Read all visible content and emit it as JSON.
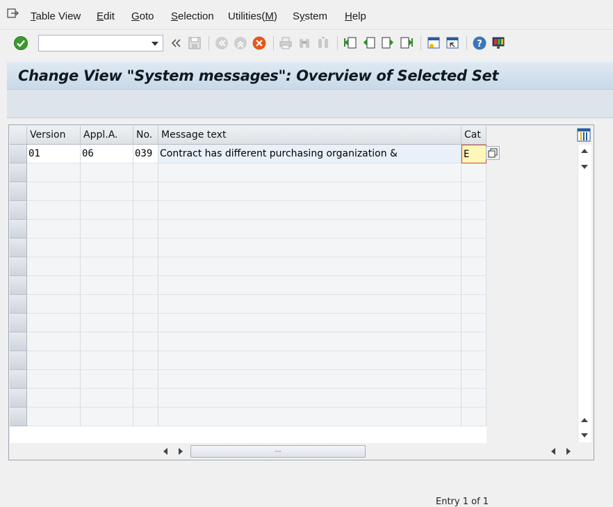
{
  "menu": {
    "items": [
      {
        "label": "Table View",
        "mnemonic": "T",
        "rest": "able View"
      },
      {
        "label": "Edit",
        "mnemonic": "E",
        "rest": "dit"
      },
      {
        "label": "Goto",
        "mnemonic": "G",
        "rest": "oto"
      },
      {
        "label": "Selection",
        "mnemonic": "S",
        "rest": "election"
      },
      {
        "label": "Utilities(M)",
        "pre": "Utilities(",
        "mnemonic": "M",
        "post": ")"
      },
      {
        "label": "System",
        "pre": "S",
        "mnemonic": "y",
        "post": "stem"
      },
      {
        "label": "Help",
        "mnemonic": "H",
        "rest": "elp"
      }
    ]
  },
  "toolbar": {
    "command_field_value": "",
    "icons": [
      "enter-icon",
      "back-arrows-icon",
      "save-icon",
      "back-icon",
      "exit-icon",
      "cancel-icon",
      "print-icon",
      "find-icon",
      "find-next-icon",
      "first-page-icon",
      "previous-page-icon",
      "next-page-icon",
      "last-page-icon",
      "create-session-icon",
      "shortcut-icon",
      "help-icon",
      "customize-layout-icon"
    ]
  },
  "title": "Change View \"System messages\": Overview of Selected Set",
  "table": {
    "columns": [
      "Version",
      "Appl.A.",
      "No.",
      "Message text",
      "Cat"
    ],
    "rows": [
      {
        "version": "01",
        "appl_area": "06",
        "number": "039",
        "message_text": "Contract has different purchasing organization &",
        "category": "E"
      }
    ],
    "empty_rows": 15
  },
  "status": {
    "entry_text": "Entry 1 of 1"
  },
  "colors": {
    "title_bar": "#c9d9e8",
    "cat_highlight": "#fff7b8",
    "enter_icon": "#3a9a2e",
    "cancel_icon": "#e05a1c"
  }
}
